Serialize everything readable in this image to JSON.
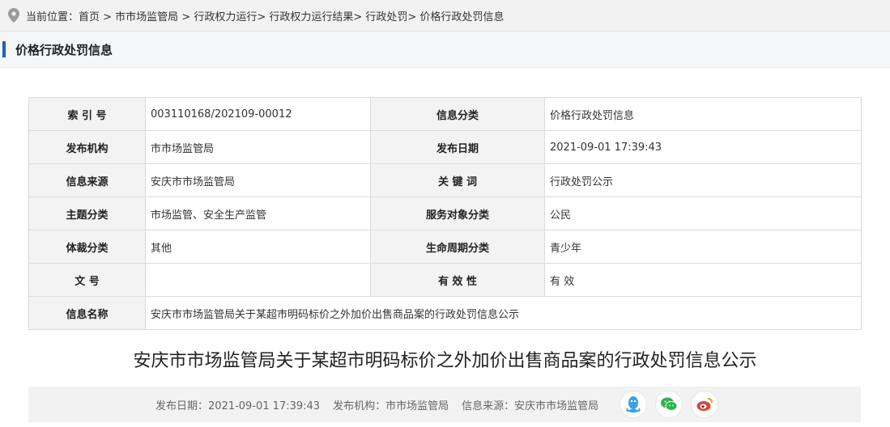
{
  "breadcrumb": {
    "prefix": "当前位置：",
    "path": "首页 > 市市场监管局 > 行政权力运行> 行政权力运行结果> 行政处罚> 价格行政处罚信息"
  },
  "page_title": "价格行政处罚信息",
  "meta": [
    {
      "label": "索 引 号",
      "value": "003110168/202109-00012",
      "label2": "信息分类",
      "value2": "价格行政处罚信息"
    },
    {
      "label": "发布机构",
      "value": "市市场监管局",
      "label2": "发布日期",
      "value2": "2021-09-01 17:39:43"
    },
    {
      "label": "信息来源",
      "value": "安庆市市场监管局",
      "label2": "关 键 词",
      "value2": "行政处罚公示"
    },
    {
      "label": "主题分类",
      "value": "市场监管、安全生产监管",
      "label2": "服务对象分类",
      "value2": "公民"
    },
    {
      "label": "体裁分类",
      "value": "其他",
      "label2": "生命周期分类",
      "value2": "青少年"
    },
    {
      "label": "文 号",
      "value": "",
      "label2": "有 效 性",
      "value2": "有 效"
    },
    {
      "label": "信息名称",
      "value": "安庆市市场监管局关于某超市明码标价之外加价出售商品案的行政处罚信息公示"
    }
  ],
  "article_title": "安庆市市场监管局关于某超市明码标价之外加价出售商品案的行政处罚信息公示",
  "info": {
    "date": "发布日期：2021-09-01 17:39:43",
    "org": "发布机构：市市场监管局",
    "source": "信息来源：安庆市市场监管局"
  },
  "colors": {
    "accent": "#1e63b5",
    "qq": "#3aa0e8",
    "wechat": "#2eb34a",
    "weibo": "#e2403a"
  },
  "icons": [
    "location-pin-icon",
    "qq-icon",
    "wechat-icon",
    "weibo-icon"
  ]
}
